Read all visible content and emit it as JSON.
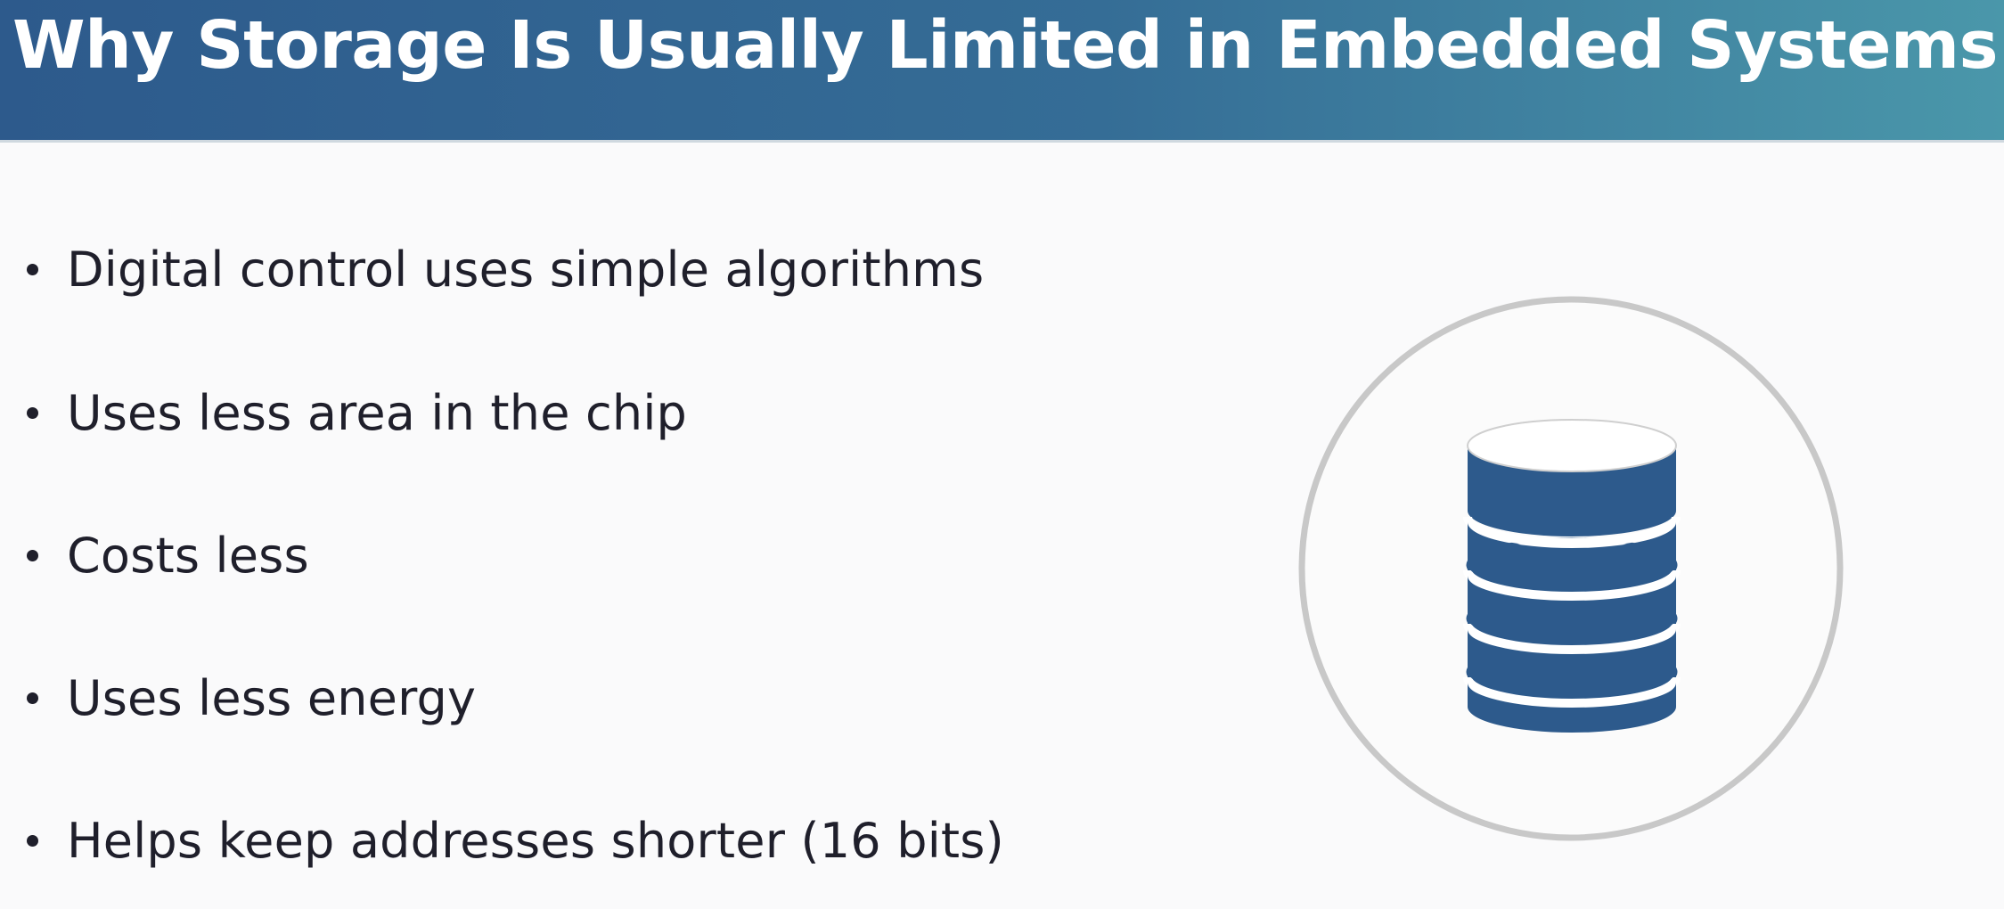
{
  "slide": {
    "title": "Why Storage Is Usually Limited in Embedded Systems",
    "bullets": [
      "Digital control uses simple algorithms",
      "Uses less area in the chip",
      "Costs less",
      "Uses less energy",
      "Helps keep addresses shorter (16 bits)"
    ],
    "icon": "database-icon"
  },
  "colors": {
    "header_start": "#2d5a8c",
    "header_end": "#4a97aa",
    "title_text": "#ffffff",
    "body_text": "#1f1f2b",
    "icon_fill": "#2d5a8c",
    "circle_stroke": "#c8c8c8",
    "background": "#fafafb"
  }
}
